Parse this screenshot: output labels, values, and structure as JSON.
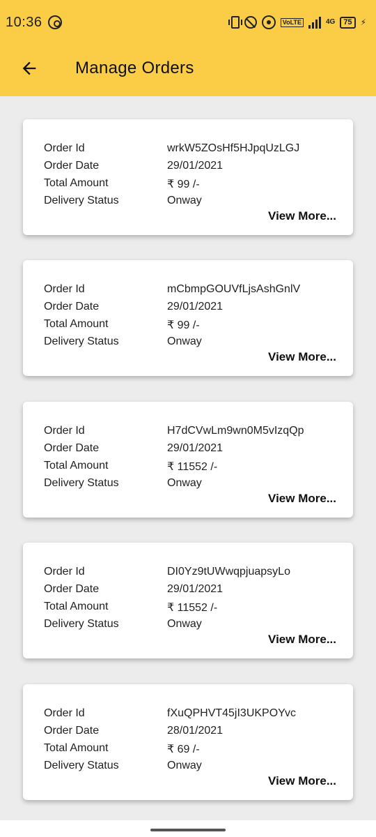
{
  "status_bar": {
    "time": "10:36",
    "network": "4G",
    "volte": "VoLTE",
    "battery": "75"
  },
  "app_bar": {
    "title": "Manage Orders",
    "back_icon": "arrow-left-icon"
  },
  "labels": {
    "order_id": "Order Id",
    "order_date": "Order Date",
    "total_amount": "Total Amount",
    "delivery_status": "Delivery Status",
    "view_more": "View More..."
  },
  "orders": [
    {
      "order_id": "wrkW5ZOsHf5HJpqUzLGJ",
      "order_date": "29/01/2021",
      "total_amount": "₹ 99 /-",
      "delivery_status": "Onway"
    },
    {
      "order_id": "mCbmpGOUVfLjsAshGnlV",
      "order_date": "29/01/2021",
      "total_amount": "₹ 99 /-",
      "delivery_status": "Onway"
    },
    {
      "order_id": "H7dCVwLm9wn0M5vIzqQp",
      "order_date": "29/01/2021",
      "total_amount": "₹ 11552 /-",
      "delivery_status": "Onway"
    },
    {
      "order_id": "DI0Yz9tUWwqpjuapsyLo",
      "order_date": "29/01/2021",
      "total_amount": "₹ 11552 /-",
      "delivery_status": "Onway"
    },
    {
      "order_id": "fXuQPHVT45jI3UKPOYvc",
      "order_date": "28/01/2021",
      "total_amount": "₹ 69 /-",
      "delivery_status": "Onway"
    }
  ],
  "colors": {
    "app_bar": "#fbcc45",
    "background": "#ececec",
    "card": "#ffffff"
  }
}
